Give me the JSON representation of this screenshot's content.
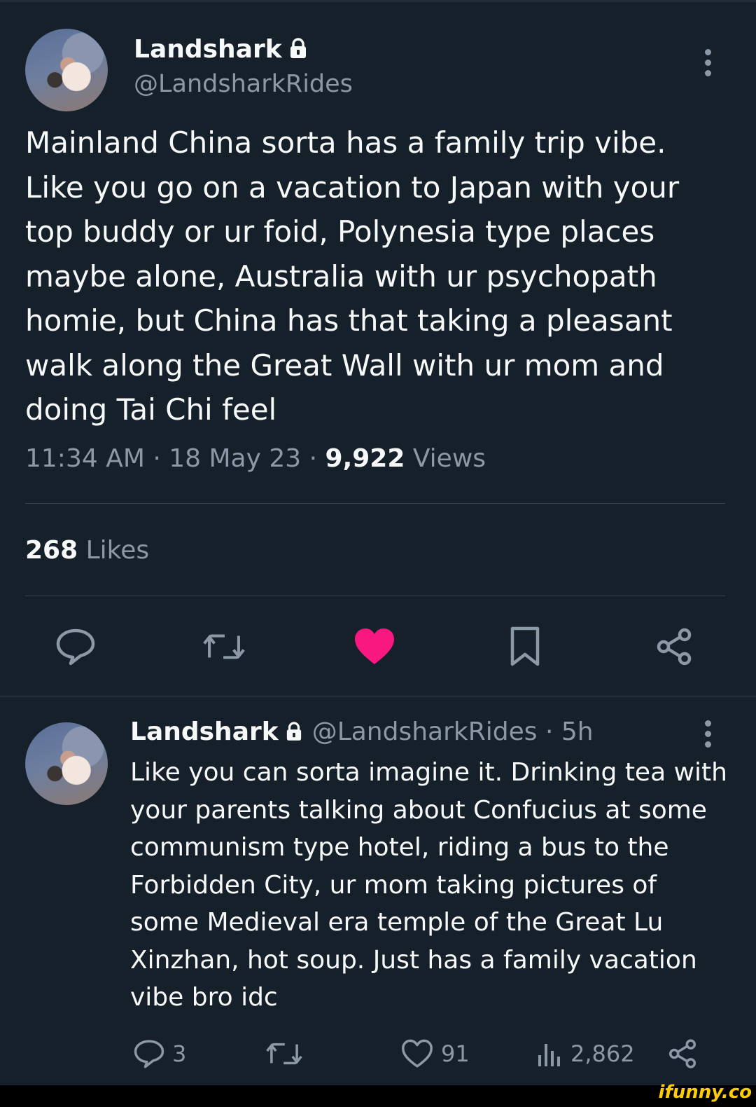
{
  "main_tweet": {
    "display_name": "Landshark",
    "handle": "@LandsharkRides",
    "text": "Mainland China sorta has a family trip vibe.\nLike you go on a vacation to Japan with your\ntop buddy or ur foid, Polynesia type places\nmaybe alone, Australia with ur psychopath\nhomie, but China has that taking a pleasant\nwalk along the Great Wall with ur mom and\ndoing Tai Chi feel",
    "time": "11:34 AM",
    "date": "18 May 23",
    "views_count": "9,922",
    "views_label": "Views",
    "likes_count": "268",
    "likes_label": "Likes"
  },
  "reply_tweet": {
    "display_name": "Landshark",
    "handle_time": "@LandsharkRides · 5h",
    "text": "Like you can sorta imagine it. Drinking tea with\nyour parents talking about Confucius at some\ncommunism type hotel, riding a bus to the\nForbidden City, ur mom taking pictures of\nsome Medieval era temple of the Great Lu\nXinzhan, hot soup. Just has a family vacation\nvibe bro idc",
    "replies": "3",
    "likes": "91",
    "views": "2,862"
  },
  "watermark": "ifunny.co",
  "colors": {
    "background": "#15202b",
    "text": "#f7f9f9",
    "secondary": "#8b98a5",
    "divider": "#38444d",
    "like_active": "#f91880"
  }
}
